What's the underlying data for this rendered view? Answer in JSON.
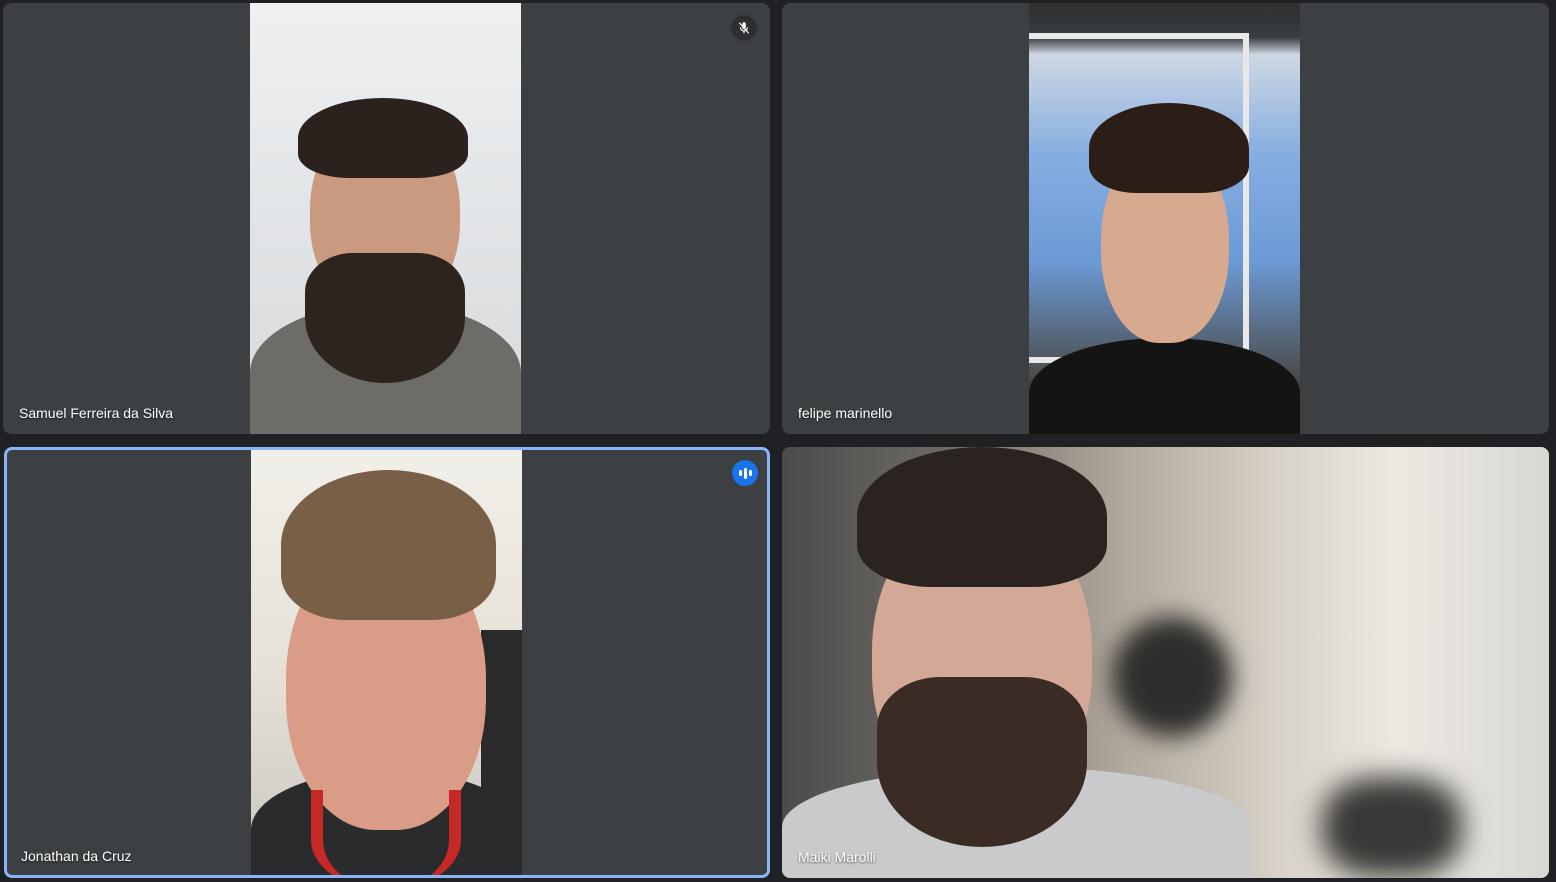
{
  "participants": [
    {
      "name": "Samuel Ferreira da Silva",
      "muted": true,
      "speaking": false
    },
    {
      "name": "felipe marinello",
      "muted": false,
      "speaking": false
    },
    {
      "name": "Jonathan da Cruz",
      "muted": false,
      "speaking": true
    },
    {
      "name": "Maiki Marolli",
      "muted": false,
      "speaking": false
    }
  ],
  "icons": {
    "muted": "mic-off-icon",
    "speaking": "audio-level-icon"
  },
  "colors": {
    "tile_background": "#3c4043",
    "page_background": "#202124",
    "speaking_border": "#8ab4f8",
    "speaking_badge": "#1a73e8"
  }
}
